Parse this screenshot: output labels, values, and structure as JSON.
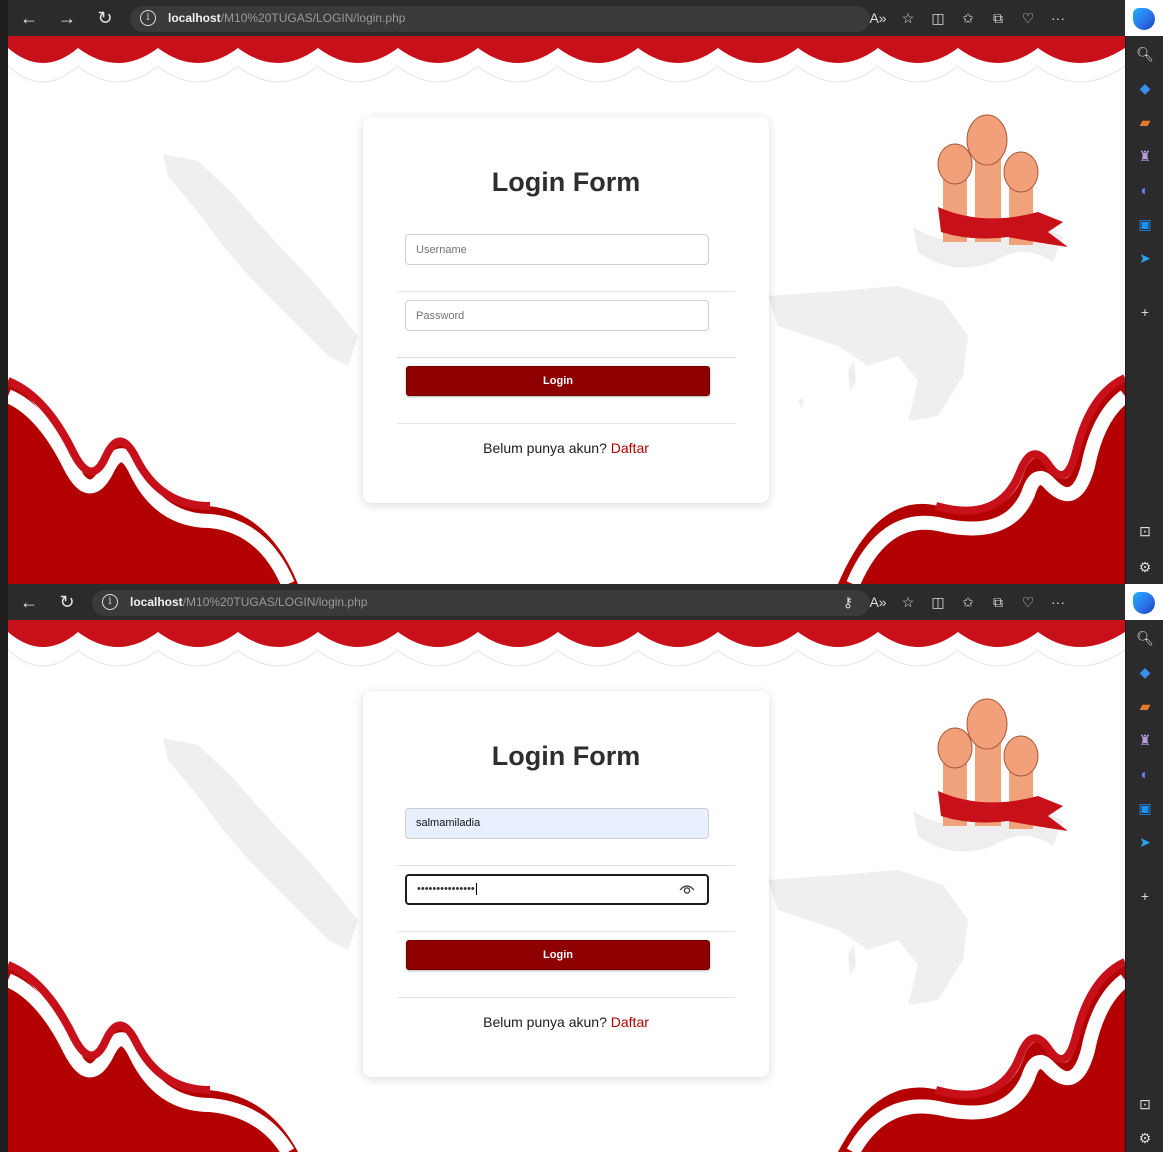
{
  "browser": {
    "url_host": "localhost",
    "url_path": "/M10%20TUGAS/LOGIN/login.php"
  },
  "login_form": {
    "title": "Login Form",
    "username_placeholder": "Username",
    "password_placeholder": "Password",
    "login_button": "Login",
    "signup_prompt": "Belum punya akun?",
    "signup_link": "Daftar"
  },
  "filled_state": {
    "username_value": "salmamiladia",
    "password_value": "•••••••••••••••"
  },
  "colors": {
    "accent_red": "#c8101a",
    "button_red": "#8e0000",
    "link_red": "#b00000",
    "autofill_blue": "#e8f0fe"
  }
}
